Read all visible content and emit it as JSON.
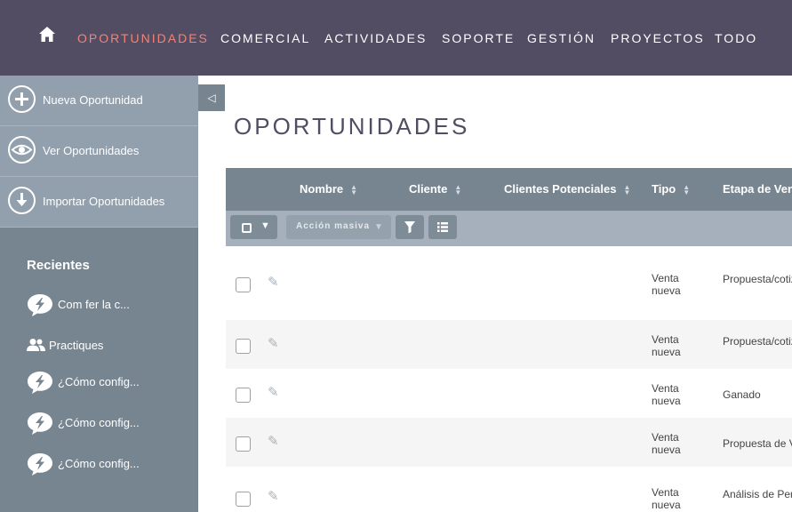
{
  "nav": {
    "home_icon": "home-icon",
    "items": [
      "OPORTUNIDADES",
      "COMERCIAL",
      "ACTIVIDADES",
      "SOPORTE",
      "GESTIÓN",
      "PROYECTOS",
      "TODO"
    ],
    "active_color": "#f08377",
    "background": "#534d64"
  },
  "sidebar": {
    "actions": [
      {
        "label": "Nueva Oportunidad",
        "icon": "plus-circle-icon"
      },
      {
        "label": "Ver Oportunidades",
        "icon": "eye-icon"
      },
      {
        "label": "Importar Oportunidades",
        "icon": "download-icon"
      }
    ],
    "recent_title": "Recientes",
    "recent": [
      {
        "label": "Com fer la c...",
        "icon": "case-icon"
      },
      {
        "label": "Practiques",
        "icon": "users-icon"
      },
      {
        "label": "¿Cómo config...",
        "icon": "case-icon"
      },
      {
        "label": "¿Cómo config...",
        "icon": "case-icon"
      },
      {
        "label": "¿Cómo config...",
        "icon": "case-icon"
      }
    ]
  },
  "collapse_glyph": "◁",
  "main": {
    "title": "OPORTUNIDADES",
    "columns": [
      "Nombre",
      "Cliente",
      "Clientes Potenciales",
      "Tipo",
      "Etapa de Venta"
    ],
    "toolbar": {
      "bulk_action_label": "Acción masiva",
      "filter_icon": "filter-icon",
      "columns_icon": "column-chooser-icon"
    },
    "rows": [
      {
        "tipo_1": "Venta",
        "tipo_2": "nueva",
        "etapa": "Propuesta/cotización"
      },
      {
        "tipo_1": "Venta",
        "tipo_2": "nueva",
        "etapa": "Propuesta/cotización"
      },
      {
        "tipo_1": "Venta",
        "tipo_2": "nueva",
        "etapa": "Ganado"
      },
      {
        "tipo_1": "Venta",
        "tipo_2": "nueva",
        "etapa": "Propuesta de Valor"
      },
      {
        "tipo_1": "Venta",
        "tipo_2": "nueva",
        "etapa": "Análisis de Percepción"
      }
    ]
  }
}
